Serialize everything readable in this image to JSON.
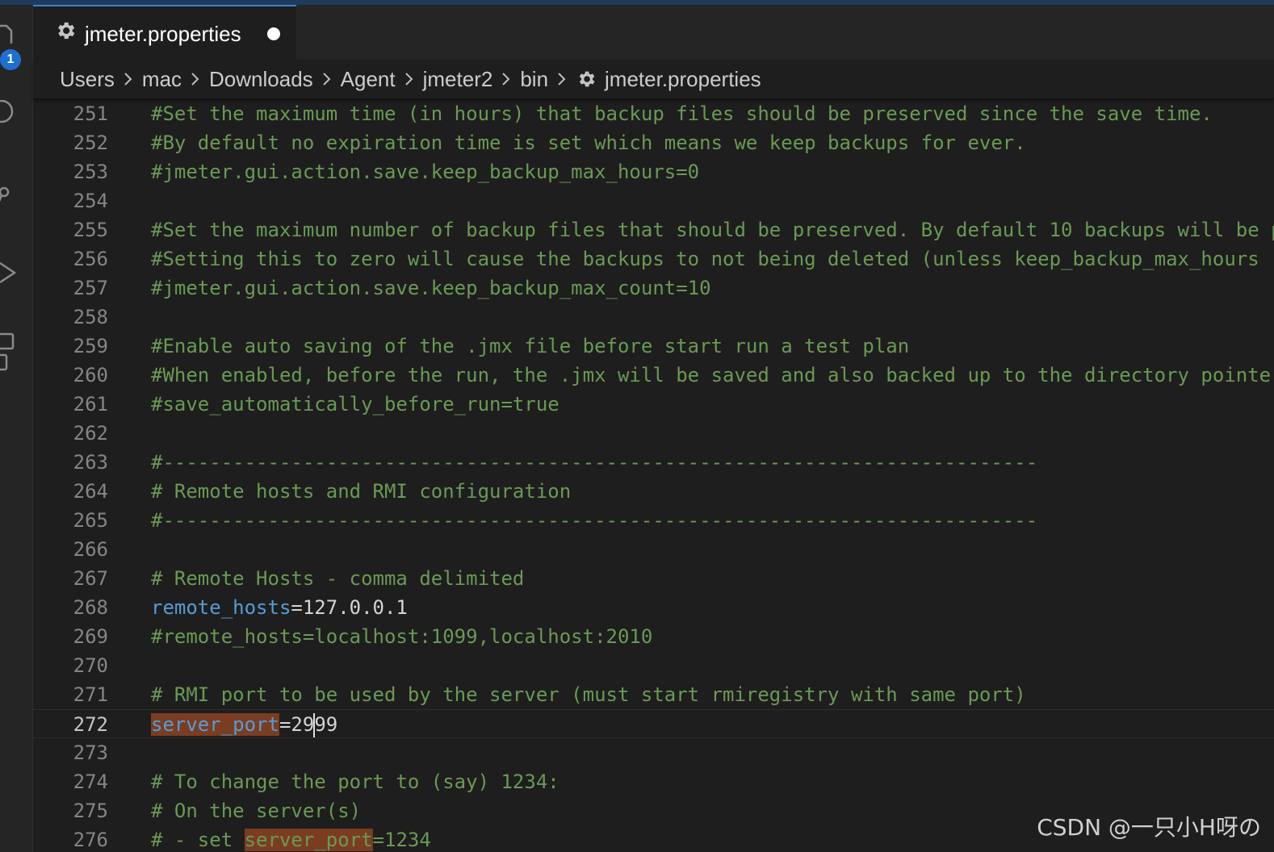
{
  "tab": {
    "label": "jmeter.properties",
    "icon": "gear-icon",
    "modified": true
  },
  "activity_bar": {
    "badge": "1"
  },
  "breadcrumb": [
    "Users",
    "mac",
    "Downloads",
    "Agent",
    "jmeter2",
    "bin",
    "jmeter.properties"
  ],
  "editor": {
    "current_line": 272,
    "lines": [
      {
        "n": "251",
        "t": "#Set the maximum time (in hours) that backup files should be preserved since the save time.",
        "k": "comment"
      },
      {
        "n": "252",
        "t": "#By default no expiration time is set which means we keep backups for ever.",
        "k": "comment"
      },
      {
        "n": "253",
        "t": "#jmeter.gui.action.save.keep_backup_max_hours=0",
        "k": "comment"
      },
      {
        "n": "254",
        "t": "",
        "k": "blank"
      },
      {
        "n": "255",
        "t": "#Set the maximum number of backup files that should be preserved. By default 10 backups will be p",
        "k": "comment"
      },
      {
        "n": "256",
        "t": "#Setting this to zero will cause the backups to not being deleted (unless keep_backup_max_hours",
        "k": "comment"
      },
      {
        "n": "257",
        "t": "#jmeter.gui.action.save.keep_backup_max_count=10",
        "k": "comment"
      },
      {
        "n": "258",
        "t": "",
        "k": "blank"
      },
      {
        "n": "259",
        "t": "#Enable auto saving of the .jmx file before start run a test plan",
        "k": "comment"
      },
      {
        "n": "260",
        "t": "#When enabled, before the run, the .jmx will be saved and also backed up to the directory pointe",
        "k": "comment"
      },
      {
        "n": "261",
        "t": "#save_automatically_before_run=true",
        "k": "comment"
      },
      {
        "n": "262",
        "t": "",
        "k": "blank"
      },
      {
        "n": "263",
        "t": "#---------------------------------------------------------------------------",
        "k": "comment"
      },
      {
        "n": "264",
        "t": "# Remote hosts and RMI configuration",
        "k": "comment"
      },
      {
        "n": "265",
        "t": "#---------------------------------------------------------------------------",
        "k": "comment"
      },
      {
        "n": "266",
        "t": "",
        "k": "blank"
      },
      {
        "n": "267",
        "t": "# Remote Hosts - comma delimited",
        "k": "comment"
      },
      {
        "n": "268",
        "key": "remote_hosts",
        "val": "=127.0.0.1",
        "k": "prop"
      },
      {
        "n": "269",
        "t": "#remote_hosts=localhost:1099,localhost:2010",
        "k": "comment"
      },
      {
        "n": "270",
        "t": "",
        "k": "blank"
      },
      {
        "n": "271",
        "t": "# RMI port to be used by the server (must start rmiregistry with same port)",
        "k": "comment"
      },
      {
        "n": "272",
        "key": "server_port",
        "val": "=2999",
        "k": "prop",
        "highlight": true,
        "cursor_after": 3
      },
      {
        "n": "273",
        "t": "",
        "k": "blank"
      },
      {
        "n": "274",
        "t": "# To change the port to (say) 1234:",
        "k": "comment"
      },
      {
        "n": "275",
        "t": "# On the server(s)",
        "k": "comment"
      },
      {
        "n": "276",
        "pre": "# - set ",
        "hl": "server_port",
        "post": "=1234",
        "k": "comment-hl"
      }
    ]
  },
  "watermark": "CSDN @一只小H呀の"
}
